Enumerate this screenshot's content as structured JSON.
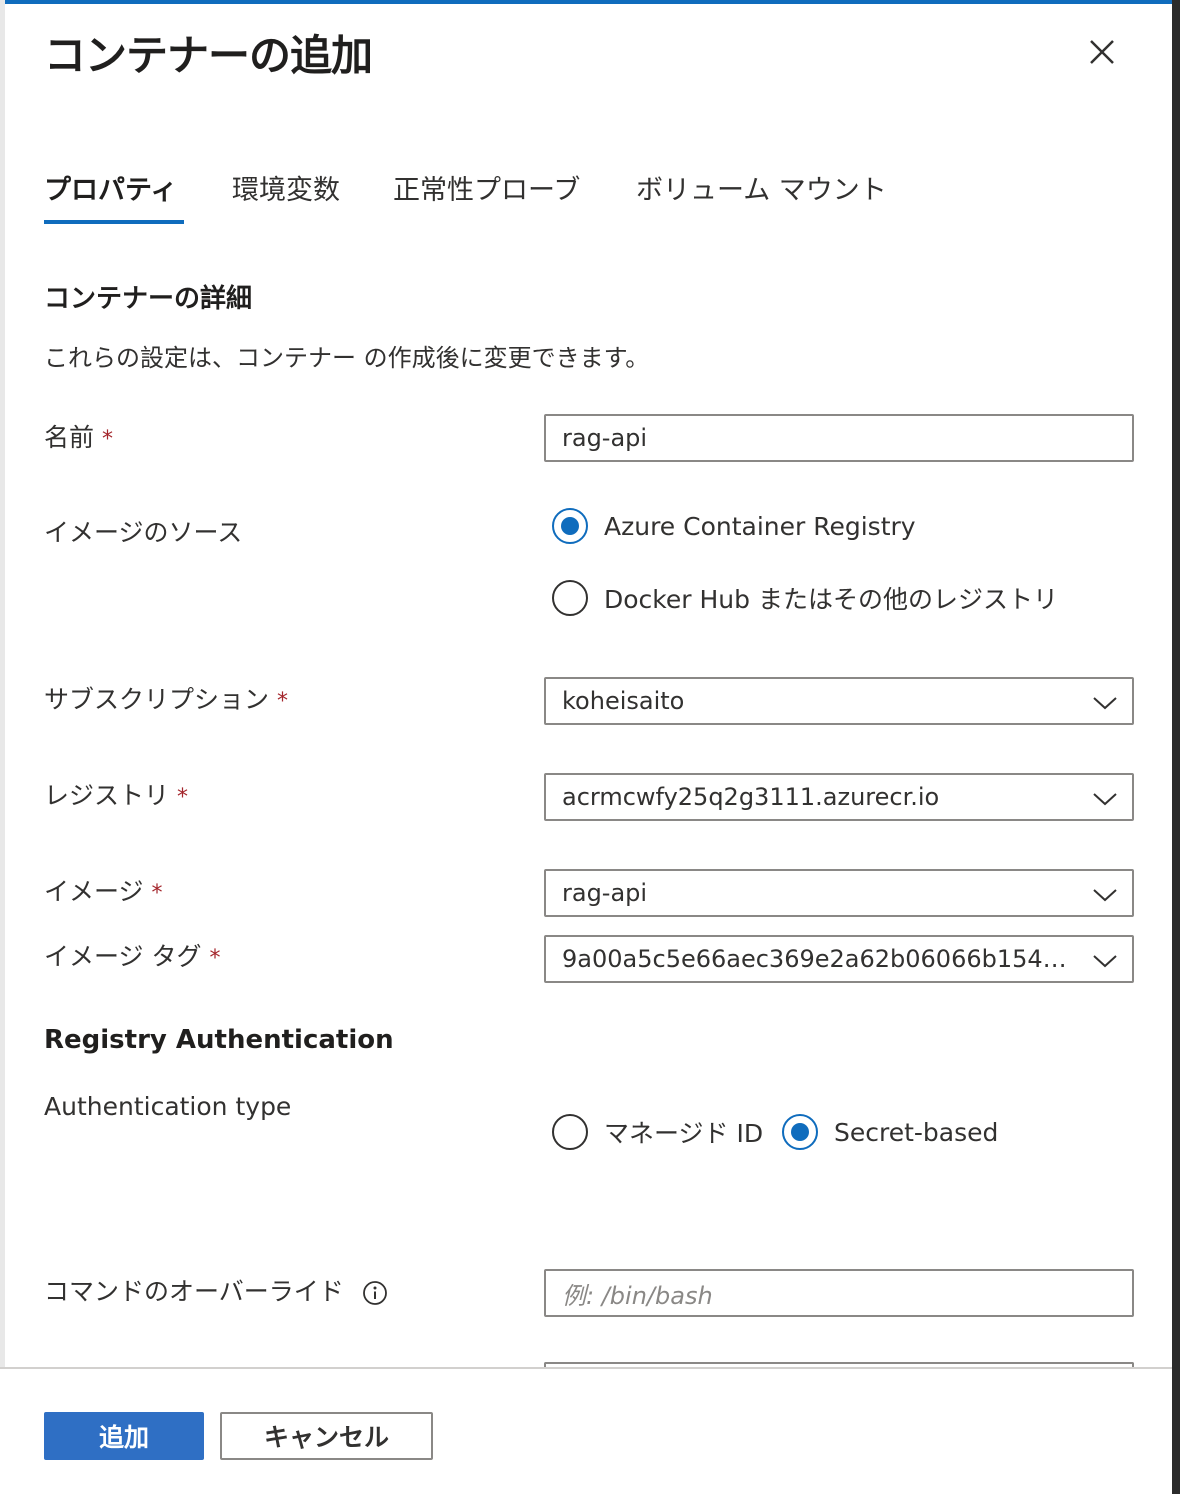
{
  "panel": {
    "title": "コンテナーの追加",
    "close_icon": "close-icon"
  },
  "tabs": [
    {
      "label": "プロパティ",
      "active": true
    },
    {
      "label": "環境変数",
      "active": false
    },
    {
      "label": "正常性プローブ",
      "active": false
    },
    {
      "label": "ボリューム マウント",
      "active": false
    }
  ],
  "details": {
    "heading": "コンテナーの詳細",
    "description": "これらの設定は、コンテナー の作成後に変更できます。"
  },
  "fields": {
    "name": {
      "label": "名前",
      "required": "*",
      "value": "rag-api"
    },
    "image_source": {
      "label": "イメージのソース",
      "options": [
        {
          "label": "Azure Container Registry",
          "selected": true
        },
        {
          "label": "Docker Hub またはその他のレジストリ",
          "selected": false
        }
      ]
    },
    "subscription": {
      "label": "サブスクリプション",
      "required": "*",
      "value": "koheisaito"
    },
    "registry": {
      "label": "レジストリ",
      "required": "*",
      "value": "acrmcwfy25q2g3111.azurecr.io"
    },
    "image": {
      "label": "イメージ",
      "required": "*",
      "value": "rag-api"
    },
    "image_tag": {
      "label": "イメージ タグ",
      "required": "*",
      "value": "9a00a5c5e66aec369e2a62b06066b154d9c..."
    }
  },
  "registry_auth": {
    "heading": "Registry Authentication",
    "type_label": "Authentication type",
    "options": [
      {
        "label": "マネージド ID",
        "selected": false
      },
      {
        "label": "Secret-based",
        "selected": true
      }
    ]
  },
  "command_override": {
    "label": "コマンドのオーバーライド",
    "placeholder": "例: /bin/bash",
    "info_icon": "info-icon"
  },
  "footer": {
    "add_label": "追加",
    "cancel_label": "キャンセル"
  },
  "colors": {
    "accent": "#0f6cbd",
    "primary_button": "#2f6fc4",
    "required": "#a4262c"
  }
}
